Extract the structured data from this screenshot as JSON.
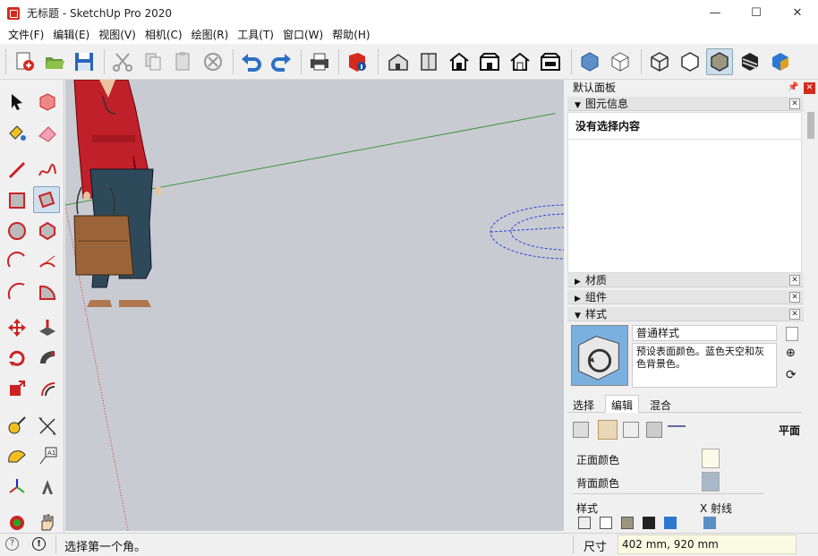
{
  "window": {
    "title": "无标题 - SketchUp Pro 2020",
    "min_glyph": "—",
    "max_glyph": "☐",
    "close_glyph": "✕"
  },
  "menu": [
    "文件(F)",
    "编辑(E)",
    "视图(V)",
    "相机(C)",
    "绘图(R)",
    "工具(T)",
    "窗口(W)",
    "帮助(H)"
  ],
  "panel": {
    "tray_title": "默认面板",
    "entity_info": {
      "title": "图元信息",
      "content": "没有选择内容"
    },
    "materials": {
      "title": "材质"
    },
    "components": {
      "title": "组件"
    },
    "styles": {
      "title": "样式",
      "style_name": "普通样式",
      "style_desc": "预设表面颜色。蓝色天空和灰色背景色。",
      "tabs": [
        "选择",
        "编辑",
        "混合"
      ],
      "active_tab": "编辑",
      "face_label": "平面",
      "front_color_label": "正面颜色",
      "back_color_label": "背面颜色",
      "style_label": "样式",
      "xray_label": "X 射线",
      "front_color": "#fafae6",
      "back_color": "#a8b8c8"
    }
  },
  "status": {
    "message": "选择第一个角。",
    "measure_label": "尺寸",
    "measure_value": "402 mm, 920 mm"
  },
  "colors": {
    "viewport_bg": "#c9cbd2",
    "accent": "#d52b1e"
  }
}
